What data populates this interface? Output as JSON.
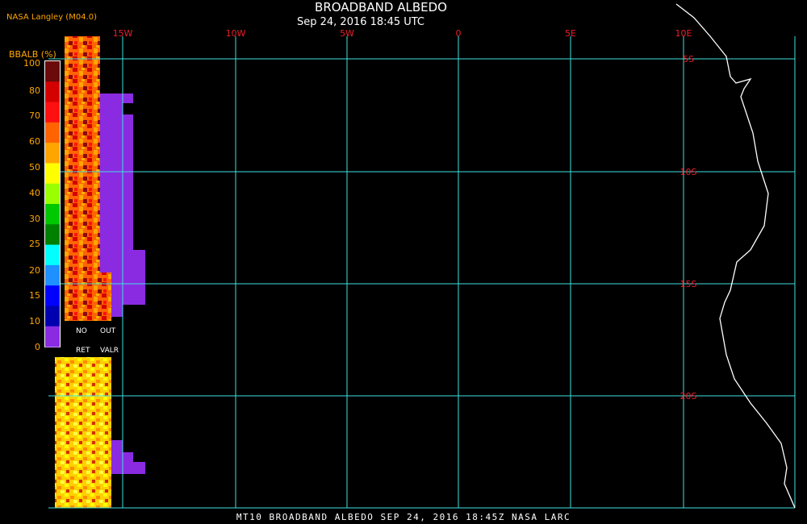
{
  "title": "BROADBAND ALBEDO",
  "subtitle": "Sep 24, 2016 18:45 UTC",
  "source": "NASA Langley (M04.0)",
  "footer": "MT10  BROADBAND ALBEDO  SEP 24, 2016 18:45Z  NASA LARC",
  "colorbar": {
    "title": "BBALB (%)",
    "ticks": [
      "100",
      "80",
      "70",
      "60",
      "50",
      "40",
      "30",
      "25",
      "20",
      "15",
      "10",
      "0"
    ],
    "colors": [
      "#6b0a0a",
      "#d40000",
      "#ff1010",
      "#ff6400",
      "#ffa500",
      "#ffff00",
      "#9aff00",
      "#00c800",
      "#008000",
      "#00ffff",
      "#1e90ff",
      "#0000ff",
      "#0000b0",
      "#8a2be2"
    ],
    "no_ret_line1": "NO",
    "no_ret_line2": "RET",
    "out_valr_line1": "OUT",
    "out_valr_line2": "VALR"
  },
  "map": {
    "lon_labels": [
      "15W",
      "10W",
      "5W",
      "0",
      "5E",
      "10E"
    ],
    "lat_labels": [
      "5S",
      "10S",
      "15S",
      "20S"
    ],
    "colors": {
      "grid": "#40e0e0",
      "labels": "#e8202a",
      "coast": "#ffffff",
      "out_of_range": "#8a2be2"
    }
  }
}
